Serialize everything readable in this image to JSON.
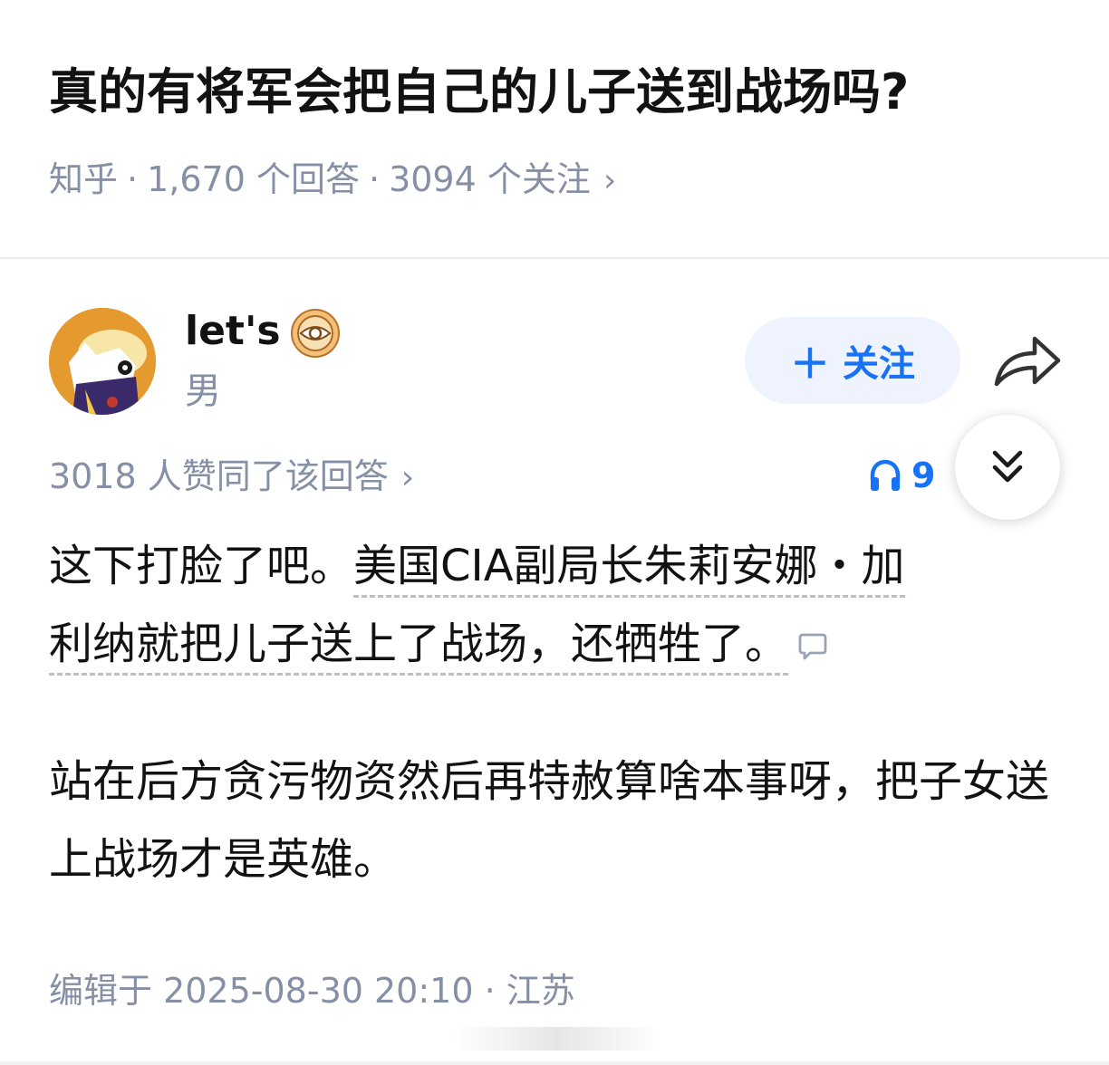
{
  "question": {
    "title": "真的有将军会把自己的儿子送到战场吗?",
    "source": "知乎",
    "answers": "1,670 个回答",
    "followers": "3094 个关注"
  },
  "author": {
    "name": "let's",
    "gender": "男",
    "avatar_icon": "cartoon-avatar",
    "badge_icon": "eye-badge-icon"
  },
  "actions": {
    "follow_label": "关注",
    "follow_icon": "plus-icon",
    "share_icon": "share-icon",
    "collapse_icon": "double-chevron-down-icon"
  },
  "answer_meta": {
    "likes": "3018 人赞同了该回答",
    "listen_count": "9"
  },
  "answer": {
    "p1_plain": "这下打脸了吧。",
    "p1_line1_marked": "美国CIA副局长朱莉安娜・加",
    "p1_line2_marked": "利纳就把儿子送上了战场，还牺牲了。",
    "p2": "站在后方贪污物资然后再特赦算啥本事呀，把子女送上战场才是英雄。"
  },
  "footer": {
    "edited": "编辑于 2025-08-30 20:10",
    "location": "江苏"
  },
  "colors": {
    "accent": "#1772f6",
    "follow_bg": "#eef3fe",
    "meta_gray": "#8590a6",
    "avatar_bg": "#e49a2f"
  }
}
